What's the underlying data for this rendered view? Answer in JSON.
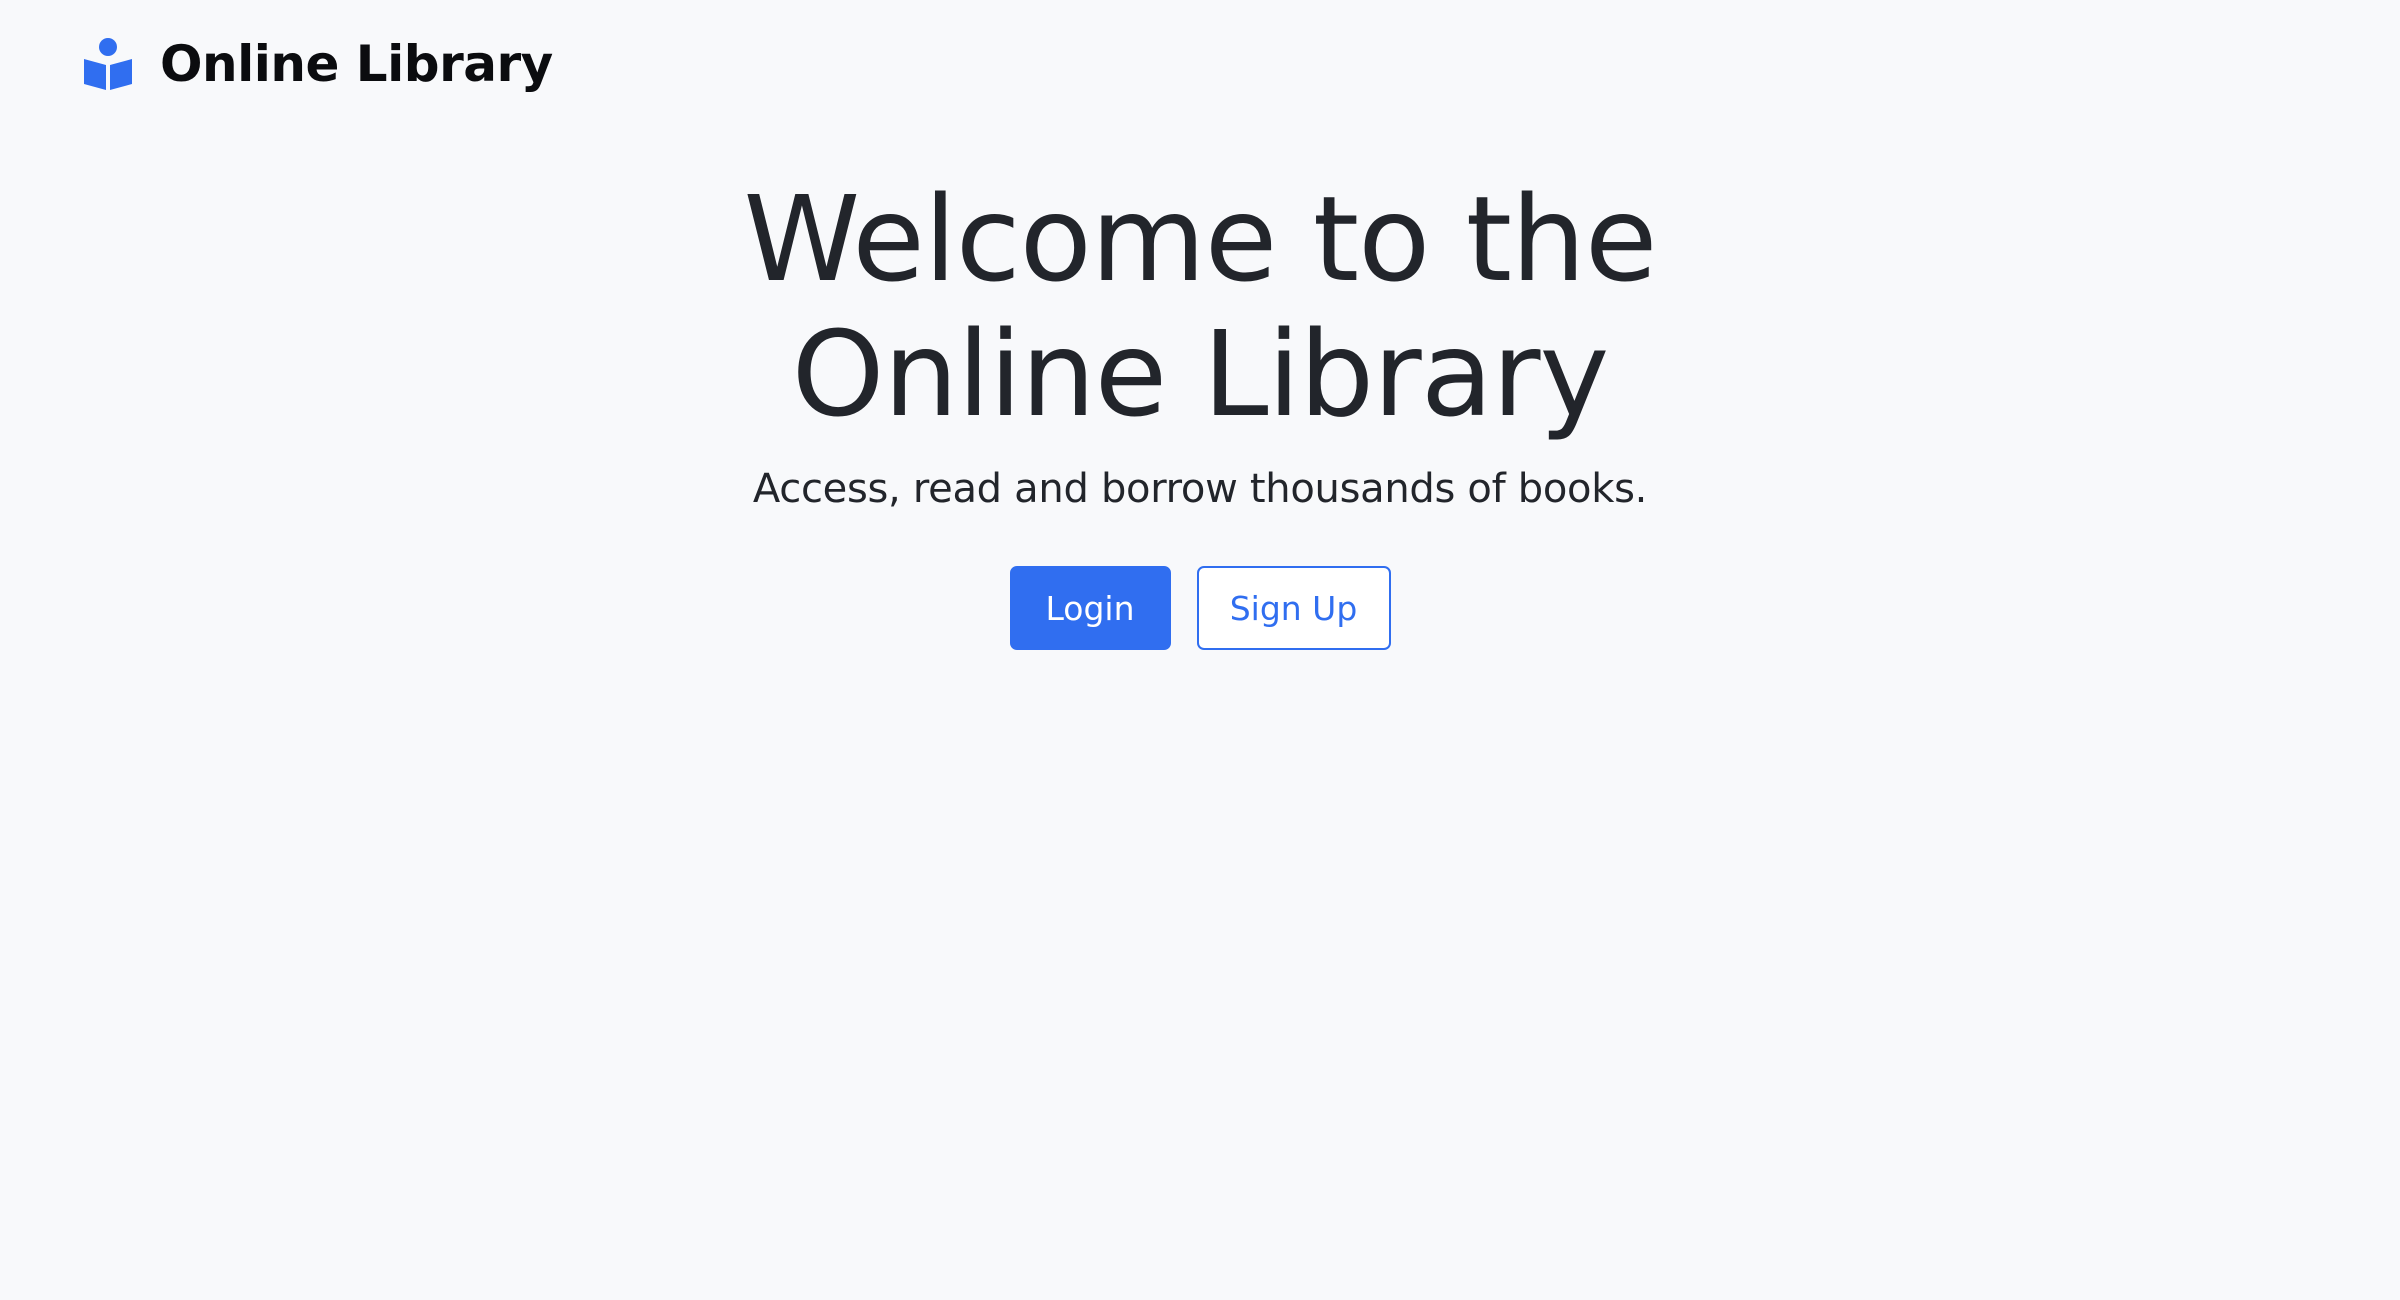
{
  "header": {
    "logo_icon": "book-reader-icon",
    "brand": "Online Library"
  },
  "hero": {
    "title": "Welcome to the Online Library",
    "subtitle": "Access, read and borrow thousands of books."
  },
  "actions": {
    "login_label": "Login",
    "signup_label": "Sign Up"
  },
  "colors": {
    "accent": "#306ef0",
    "background": "#f8f9fb",
    "text": "#22252b"
  }
}
